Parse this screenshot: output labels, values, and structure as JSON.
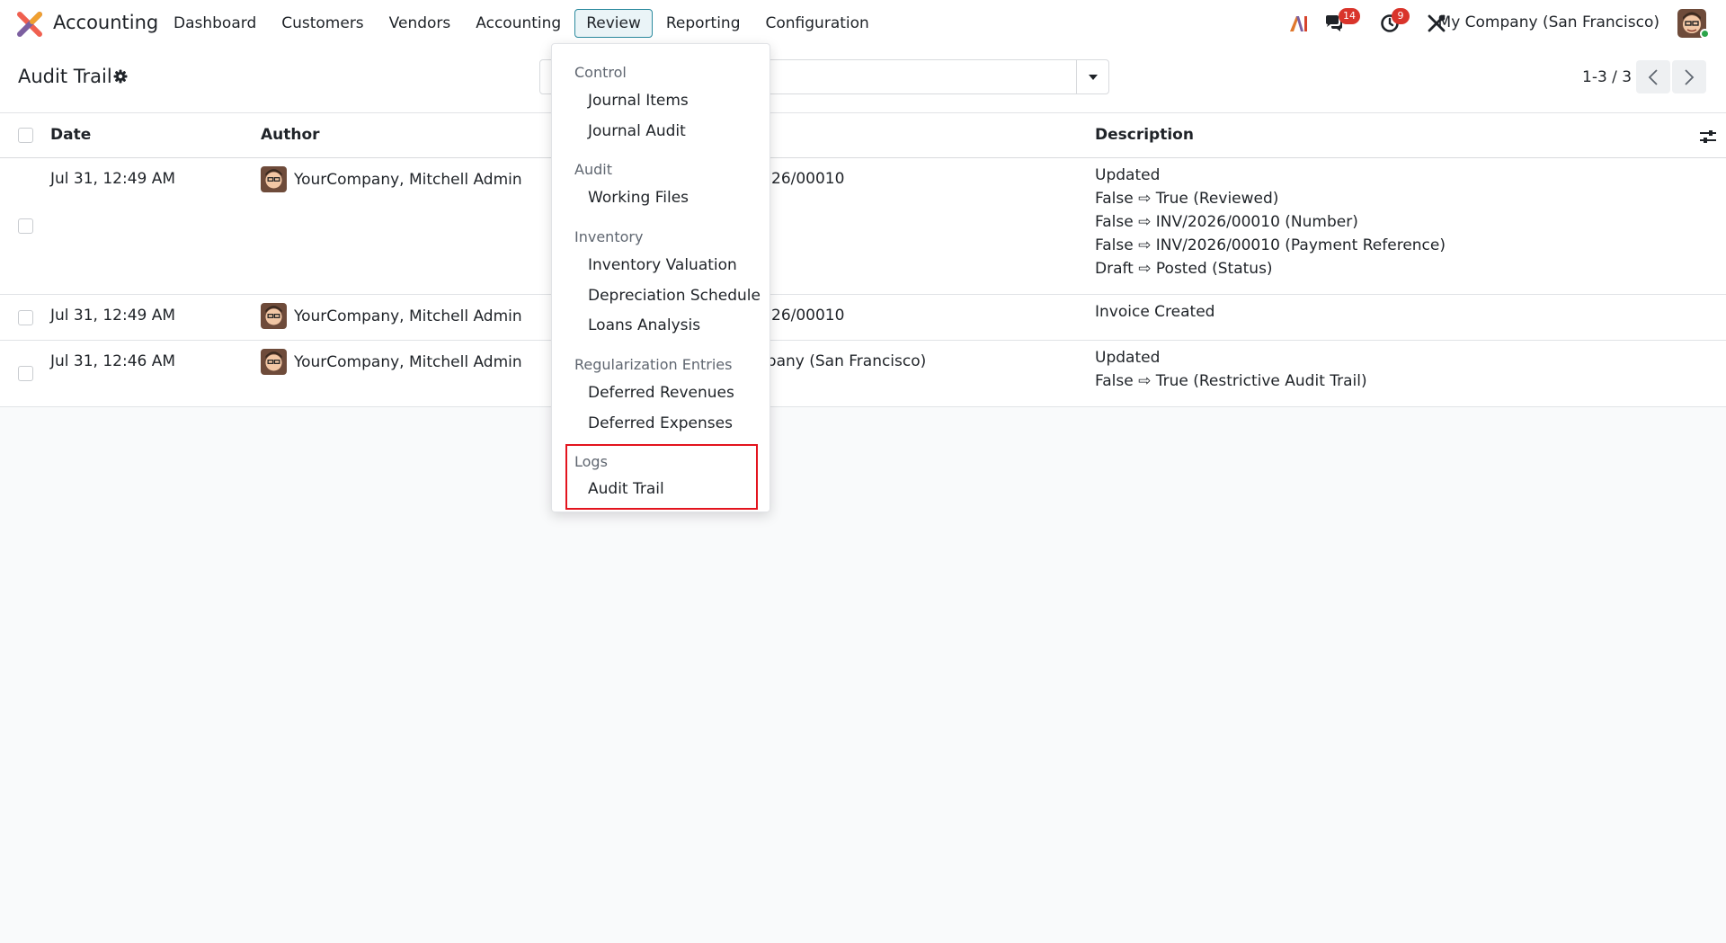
{
  "navbar": {
    "app_name": "Accounting",
    "menu": [
      "Dashboard",
      "Customers",
      "Vendors",
      "Accounting",
      "Review",
      "Reporting",
      "Configuration"
    ],
    "active_menu": "Review",
    "messages_count": "14",
    "activities_count": "9",
    "company": "My Company (San Francisco)"
  },
  "control_panel": {
    "title": "Audit Trail",
    "search_placeholder": "",
    "pager": "1-3 / 3"
  },
  "table": {
    "columns": [
      "Date",
      "Author",
      "Description"
    ],
    "rows": [
      {
        "date": "Jul 31, 12:49 AM",
        "author": "YourCompany, Mitchell Admin",
        "record": "26/00010",
        "description": [
          "Updated",
          "False ⇨ True (Reviewed)",
          "False ⇨ INV/2026/00010 (Number)",
          "False ⇨ INV/2026/00010 (Payment Reference)",
          "Draft ⇨ Posted (Status)"
        ]
      },
      {
        "date": "Jul 31, 12:49 AM",
        "author": "YourCompany, Mitchell Admin",
        "record": "26/00010",
        "description": [
          "Invoice Created"
        ]
      },
      {
        "date": "Jul 31, 12:46 AM",
        "author": "YourCompany, Mitchell Admin",
        "record": "npany (San Francisco)",
        "description": [
          "Updated",
          "False ⇨ True (Restrictive Audit Trail)"
        ]
      }
    ]
  },
  "dropdown": {
    "sections": [
      {
        "title": "Control",
        "items": [
          "Journal Items",
          "Journal Audit"
        ]
      },
      {
        "title": "Audit",
        "items": [
          "Working Files"
        ]
      },
      {
        "title": "Inventory",
        "items": [
          "Inventory Valuation",
          "Depreciation Schedule",
          "Loans Analysis"
        ]
      },
      {
        "title": "Regularization Entries",
        "items": [
          "Deferred Revenues",
          "Deferred Expenses"
        ]
      },
      {
        "title": "Logs",
        "items": [
          "Audit Trail"
        ]
      }
    ]
  },
  "colors": {
    "accent": "#2b8a9e",
    "badge": "#d9342b",
    "highlight": "#e3141e"
  }
}
